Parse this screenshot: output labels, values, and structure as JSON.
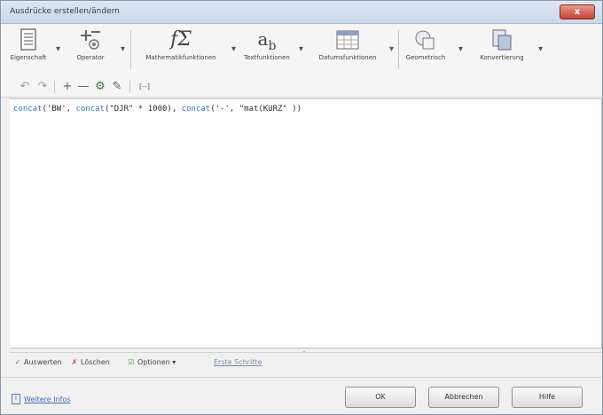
{
  "window": {
    "title": "Ausdrücke erstellen/ändern",
    "close_label": "x"
  },
  "ribbon": {
    "items": [
      {
        "label": "Eigenschaft",
        "icon": "properties-icon"
      },
      {
        "label": "Operator",
        "icon": "operator-icon"
      },
      {
        "label": "Mathematikfunktionen",
        "icon": "math-function-icon"
      },
      {
        "label": "Textfunktionen",
        "icon": "text-function-icon"
      },
      {
        "label": "Datumsfunktionen",
        "icon": "date-function-icon"
      },
      {
        "label": "Geometrisch",
        "icon": "geometry-icon"
      },
      {
        "label": "Konvertierung",
        "icon": "conversion-icon"
      }
    ],
    "math_glyph": "fΣ",
    "text_glyph_main": "a",
    "text_glyph_sub": "b"
  },
  "toolbar": {
    "bracket_label": "[--]"
  },
  "editor": {
    "tokens": [
      {
        "type": "fn",
        "text": "concat"
      },
      {
        "type": "str",
        "text": "('BW', "
      },
      {
        "type": "fn",
        "text": "concat"
      },
      {
        "type": "str",
        "text": "(\"DJR\" * 1000), "
      },
      {
        "type": "fn",
        "text": "concat"
      },
      {
        "type": "str",
        "text": "('-', \"mat(KURZ\" ))"
      }
    ]
  },
  "statusbar": {
    "evaluate": "Auswerten",
    "delete": "Löschen",
    "options": "Optionen",
    "first_steps": "Erste Schritte"
  },
  "footer": {
    "help": "Weitere Infos",
    "ok": "OK",
    "cancel": "Abbrechen",
    "help_button": "Hilfe"
  },
  "colors": {
    "function_blue": "#3a6fc0",
    "close_red": "#c5432f"
  }
}
